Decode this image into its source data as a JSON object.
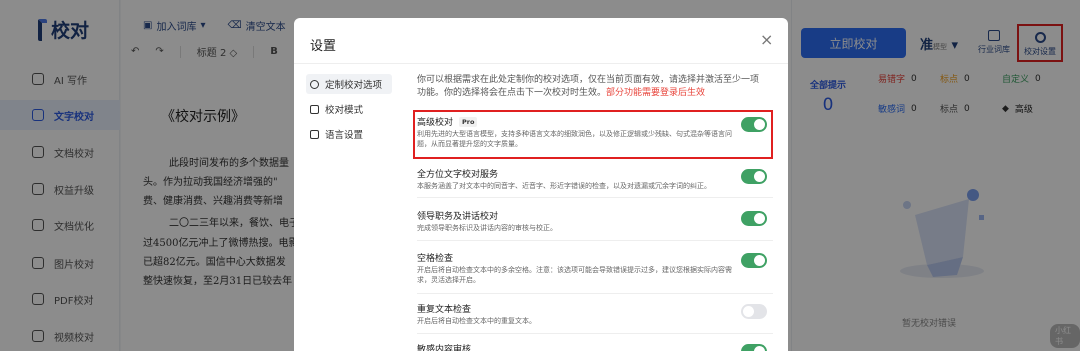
{
  "app": {
    "logo_text": "校对"
  },
  "sidebar": {
    "items": [
      {
        "label": "AI 写作",
        "icon": "sparkle-icon"
      },
      {
        "label": "文字校对",
        "icon": "doc-check-icon"
      },
      {
        "label": "文档校对",
        "icon": "file-icon"
      },
      {
        "label": "权益升级",
        "icon": "trend-icon"
      },
      {
        "label": "文档优化",
        "icon": "optimize-icon"
      },
      {
        "label": "图片校对",
        "icon": "image-icon"
      },
      {
        "label": "PDF校对",
        "icon": "pdf-icon"
      },
      {
        "label": "视频校对",
        "icon": "video-icon"
      }
    ]
  },
  "toolbar": {
    "add_lexicon": "加入词库",
    "clear_text": "清空文本",
    "heading": "标题 2",
    "bold": "B"
  },
  "document": {
    "title": "《校对示例》",
    "paragraphs": [
      "此段时间发布的多个数据量",
      "头。作为拉动我国经济增强的\"",
      "费、健康消费、兴趣消费等新增",
      "二〇二三年以来，餐饮、电子",
      "过4500亿元冲上了微博热搜。电影",
      "已超82亿元。国信中心大数据发",
      "整快速恢复，至2月31日已较去年"
    ]
  },
  "right_panel": {
    "check_button": "立即校对",
    "model_label": "准",
    "model_sub": "模型",
    "lexicon_button": "行业词库",
    "settings_button": "校对设置",
    "total_label": "全部提示",
    "total_value": "0",
    "stats": [
      {
        "label": "易错字",
        "value": "0",
        "color": "#e8443b"
      },
      {
        "label": "标点",
        "value": "0",
        "color": "#f0a020"
      },
      {
        "label": "自定义",
        "value": "0",
        "color": "#3fa164"
      },
      {
        "label": "敏感词",
        "value": "0",
        "color": "#2d6ef5"
      },
      {
        "label": "标点",
        "value": "0",
        "color": "#555555"
      },
      {
        "label": "高级",
        "value": "",
        "color": "#222222"
      }
    ],
    "empty_text": "暂无校对错误",
    "watermark": "小红书"
  },
  "modal": {
    "title": "设置",
    "close": "×",
    "nav": [
      {
        "label": "定制校对选项",
        "icon": "settings-icon"
      },
      {
        "label": "校对模式",
        "icon": "file-icon"
      },
      {
        "label": "语言设置",
        "icon": "book-icon"
      }
    ],
    "intro_text": "你可以根据需求在此处定制你的校对选项，仅在当前页面有效，请选择并激活至少一项功能。你的选择将会在点击下一次校对时生效。",
    "intro_red": "部分功能需要登录后生效",
    "options": [
      {
        "name": "高级校对",
        "badge": "Pro",
        "desc": "利用先进的大型语言模型，支持多种语言文本的细致润色，以及修正逻辑或少残缺、句式混杂等语言问题，从而显著提升您的文字质量。",
        "enabled": true
      },
      {
        "name": "全方位文字校对服务",
        "desc": "本服务涵盖了对文本中的同音字、近音字、形近字错误的检查，以及对遗漏或冗余字词的纠正。",
        "enabled": true
      },
      {
        "name": "领导职务及讲话校对",
        "desc": "完成领导职务标识及讲话内容的审核与校正。",
        "enabled": true
      },
      {
        "name": "空格检查",
        "desc": "开启后将自动检查文本中的多余空格。注意：该选项可能会导致错误提示过多，建议您根据实际内容需求，灵活选择开启。",
        "enabled": true
      },
      {
        "name": "重复文本检查",
        "desc": "开启后将自动检查文本中的重复文本。",
        "enabled": false
      },
      {
        "name": "敏感内容审核",
        "desc": "",
        "enabled": true
      }
    ]
  },
  "colors": {
    "accent": "#2d6ef5",
    "toggle_on": "#3fa164",
    "highlight": "#e02020"
  }
}
